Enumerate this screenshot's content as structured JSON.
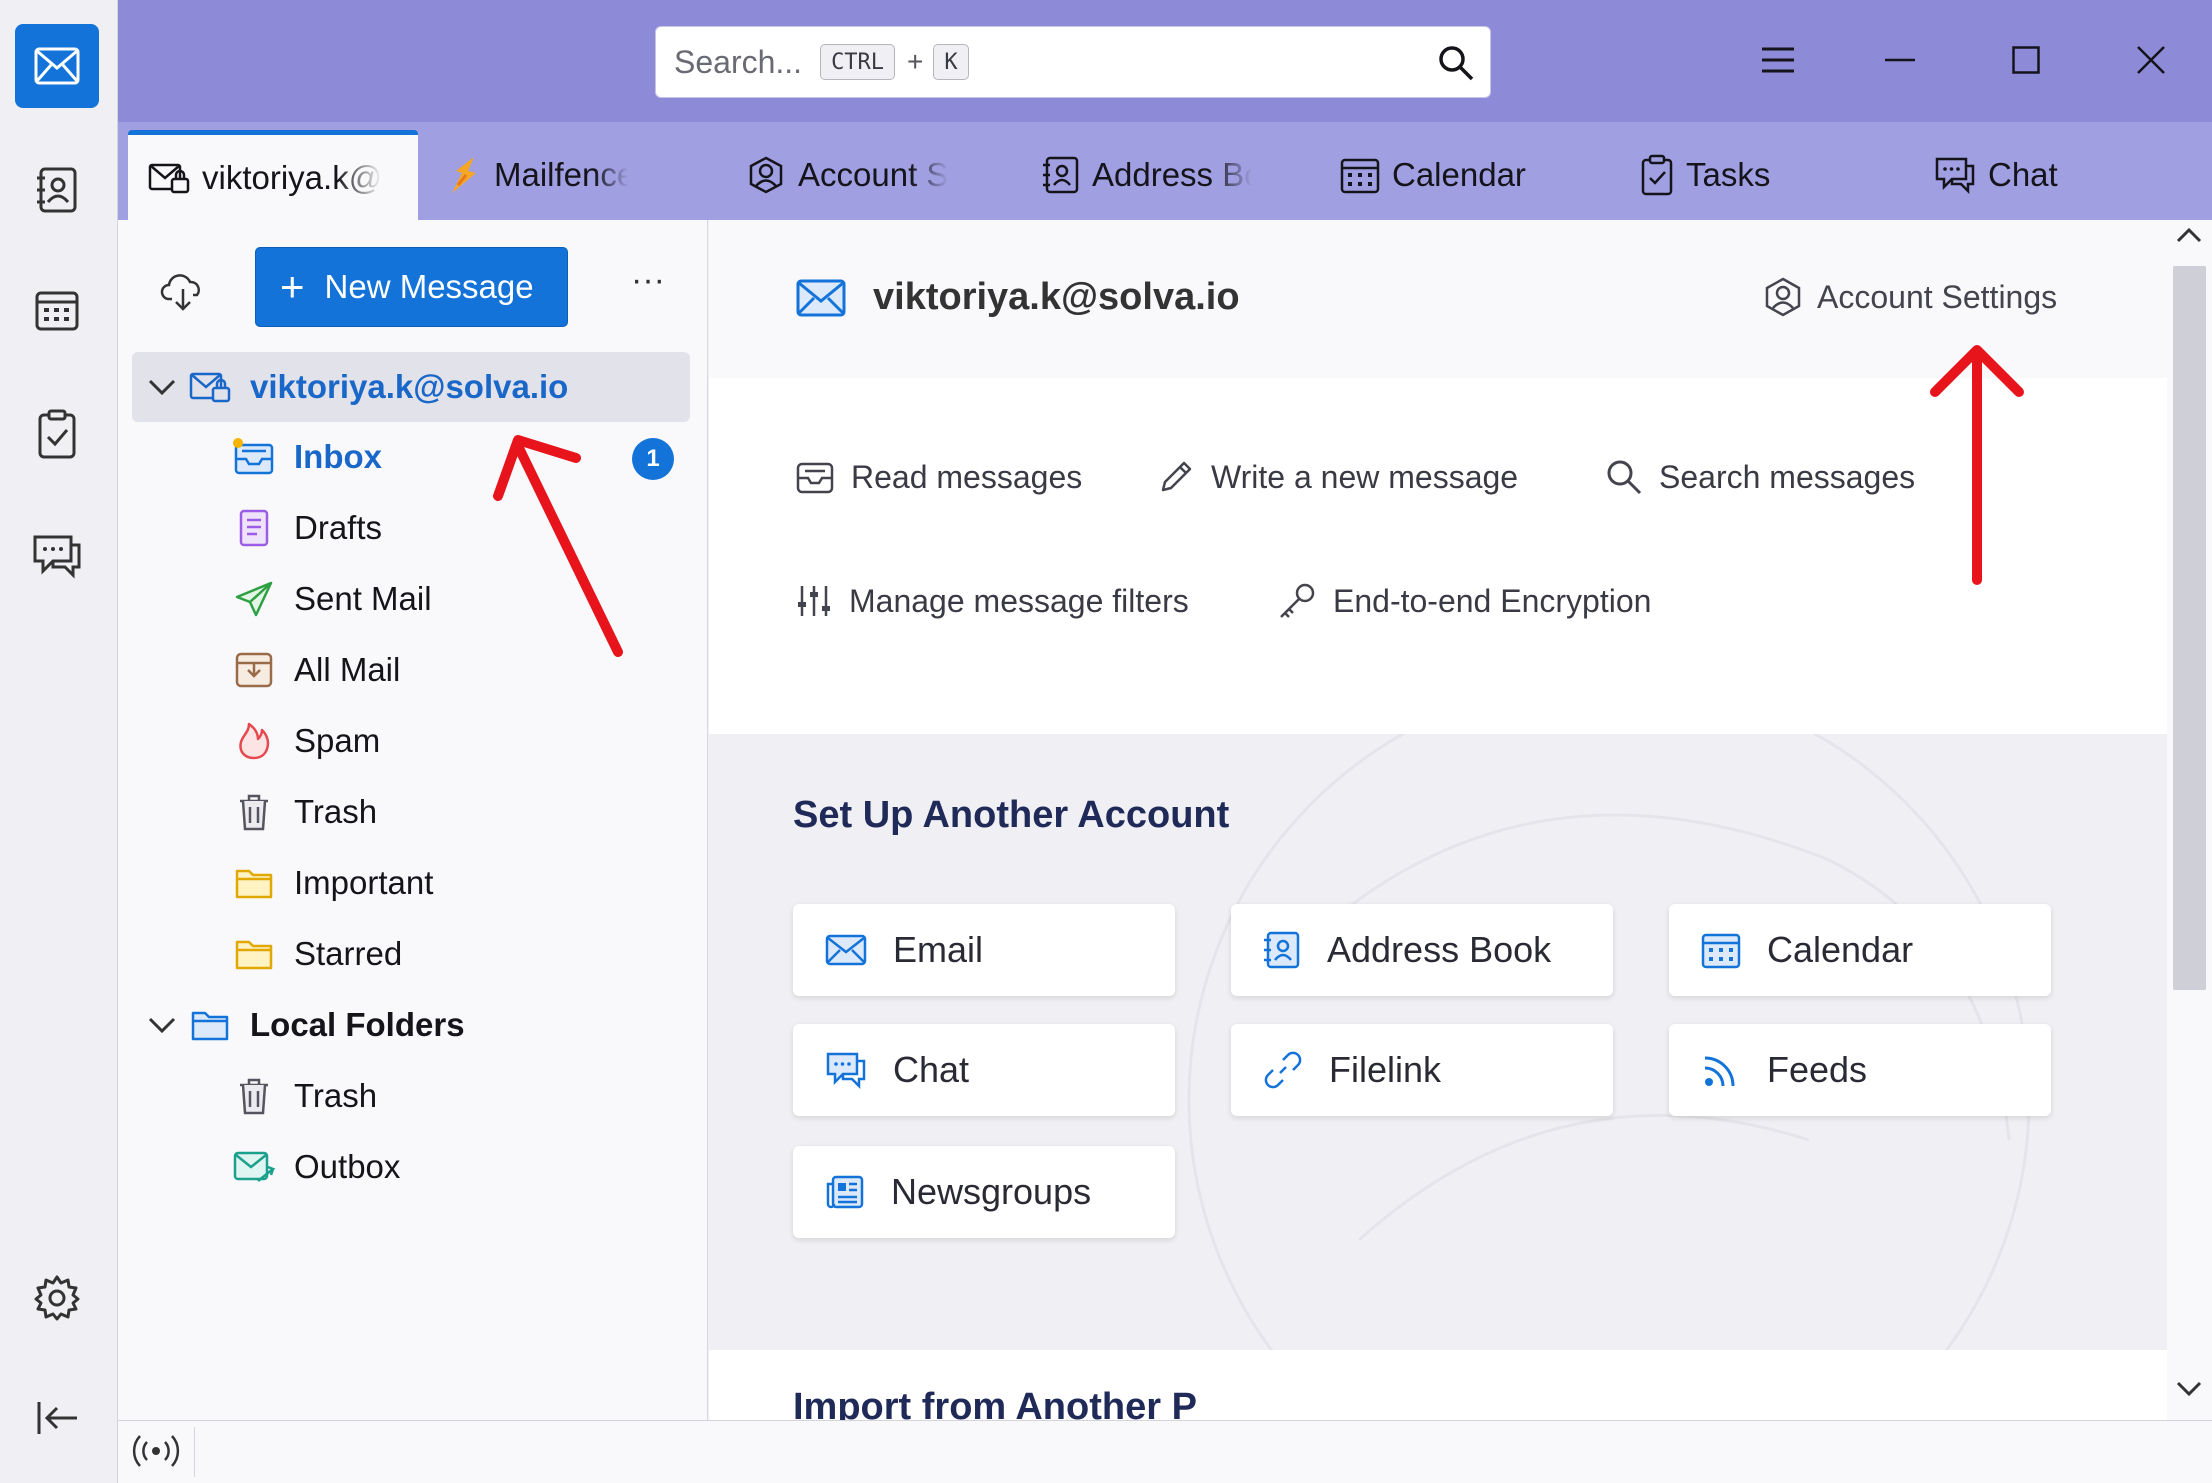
{
  "search": {
    "placeholder": "Search...",
    "shortcut_ctrl": "CTRL",
    "shortcut_plus": "+",
    "shortcut_key": "K"
  },
  "tabs": [
    {
      "label": "viktoriya.k@",
      "icon": "mail-lock-icon",
      "active": true
    },
    {
      "label": "Mailfence - S",
      "icon": "mailfence-logo-icon"
    },
    {
      "label": "Account Sett",
      "icon": "account-icon"
    },
    {
      "label": "Address Boo",
      "icon": "address-book-icon"
    },
    {
      "label": "Calendar",
      "icon": "calendar-icon"
    },
    {
      "label": "Tasks",
      "icon": "tasks-icon"
    },
    {
      "label": "Chat",
      "icon": "chat-icon"
    }
  ],
  "folder_pane": {
    "new_message_label": "New Message",
    "more_label": "···",
    "account": "viktoriya.k@solva.io",
    "folders": [
      {
        "label": "Inbox",
        "icon": "inbox-icon",
        "badge": "1"
      },
      {
        "label": "Drafts",
        "icon": "drafts-icon"
      },
      {
        "label": "Sent Mail",
        "icon": "sent-icon"
      },
      {
        "label": "All Mail",
        "icon": "archive-icon"
      },
      {
        "label": "Spam",
        "icon": "spam-icon"
      },
      {
        "label": "Trash",
        "icon": "trash-icon"
      },
      {
        "label": "Important",
        "icon": "folder-icon"
      },
      {
        "label": "Starred",
        "icon": "folder-icon"
      }
    ],
    "local_folders": "Local Folders",
    "local_items": [
      {
        "label": "Trash",
        "icon": "trash-icon"
      },
      {
        "label": "Outbox",
        "icon": "outbox-icon"
      }
    ]
  },
  "content": {
    "account_title": "viktoriya.k@solva.io",
    "account_settings": "Account Settings",
    "actions": {
      "read": "Read messages",
      "write": "Write a new message",
      "search": "Search messages",
      "filters": "Manage message filters",
      "e2e": "End-to-end Encryption"
    },
    "setup_title": "Set Up Another Account",
    "setup_cards": [
      "Email",
      "Address Book",
      "Calendar",
      "Chat",
      "Filelink",
      "Feeds",
      "Newsgroups"
    ],
    "import_title": "Import from Another P"
  },
  "colors": {
    "accent": "#1373d9",
    "titlebar": "#8d8ad8",
    "tabbar": "#a09fe2",
    "annotation": "#e8141c"
  }
}
